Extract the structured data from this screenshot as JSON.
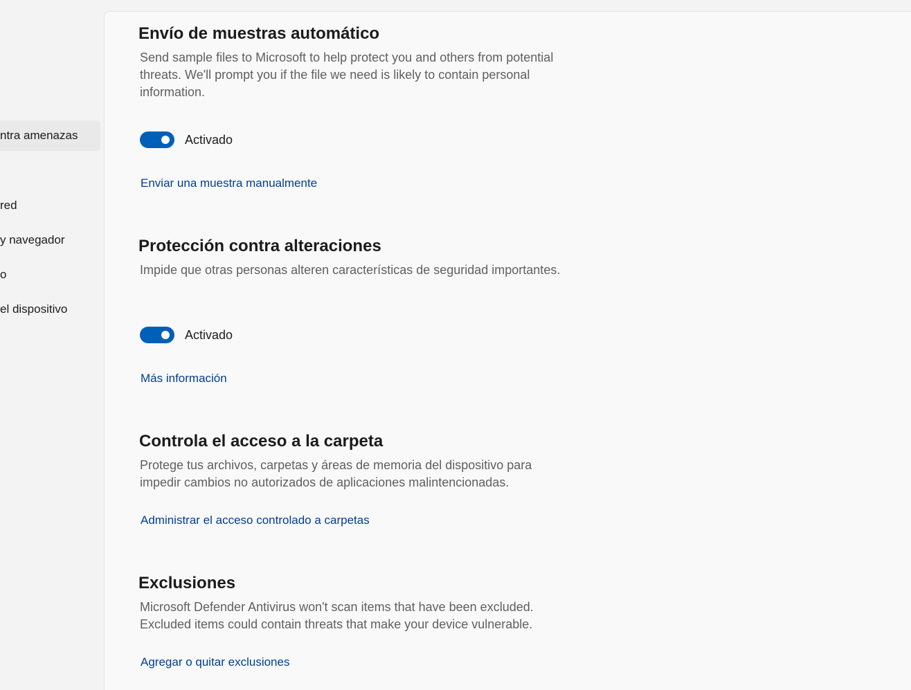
{
  "sidebar": {
    "items": [
      {
        "label": "ntra amenazas",
        "selected": true
      },
      {
        "label": "red"
      },
      {
        "label": "y navegador"
      },
      {
        "label": "o"
      },
      {
        "label": "el dispositivo"
      }
    ]
  },
  "sections": {
    "samples": {
      "title": "Envío de muestras automático",
      "description": "Send sample files to Microsoft to help protect you and others from potential threats. We'll prompt you if the file we need is likely to contain personal information.",
      "toggle_label": "Activado",
      "link": "Enviar una muestra manualmente"
    },
    "tamper": {
      "title": "Protección contra alteraciones",
      "description": "Impide que otras personas alteren características de seguridad importantes.",
      "toggle_label": "Activado",
      "link": "Más información"
    },
    "folder": {
      "title": "Controla el acceso a la carpeta",
      "description": "Protege tus archivos, carpetas y áreas de memoria del dispositivo para impedir cambios no autorizados de aplicaciones malintencionadas.",
      "link": "Administrar el acceso controlado a carpetas"
    },
    "exclusions": {
      "title": "Exclusiones",
      "description": "Microsoft Defender Antivirus won't scan items that have been excluded. Excluded items could contain threats that make your device vulnerable.",
      "link": "Agregar o quitar exclusiones"
    }
  },
  "colors": {
    "accent": "#005fb8",
    "link": "#003e92"
  }
}
